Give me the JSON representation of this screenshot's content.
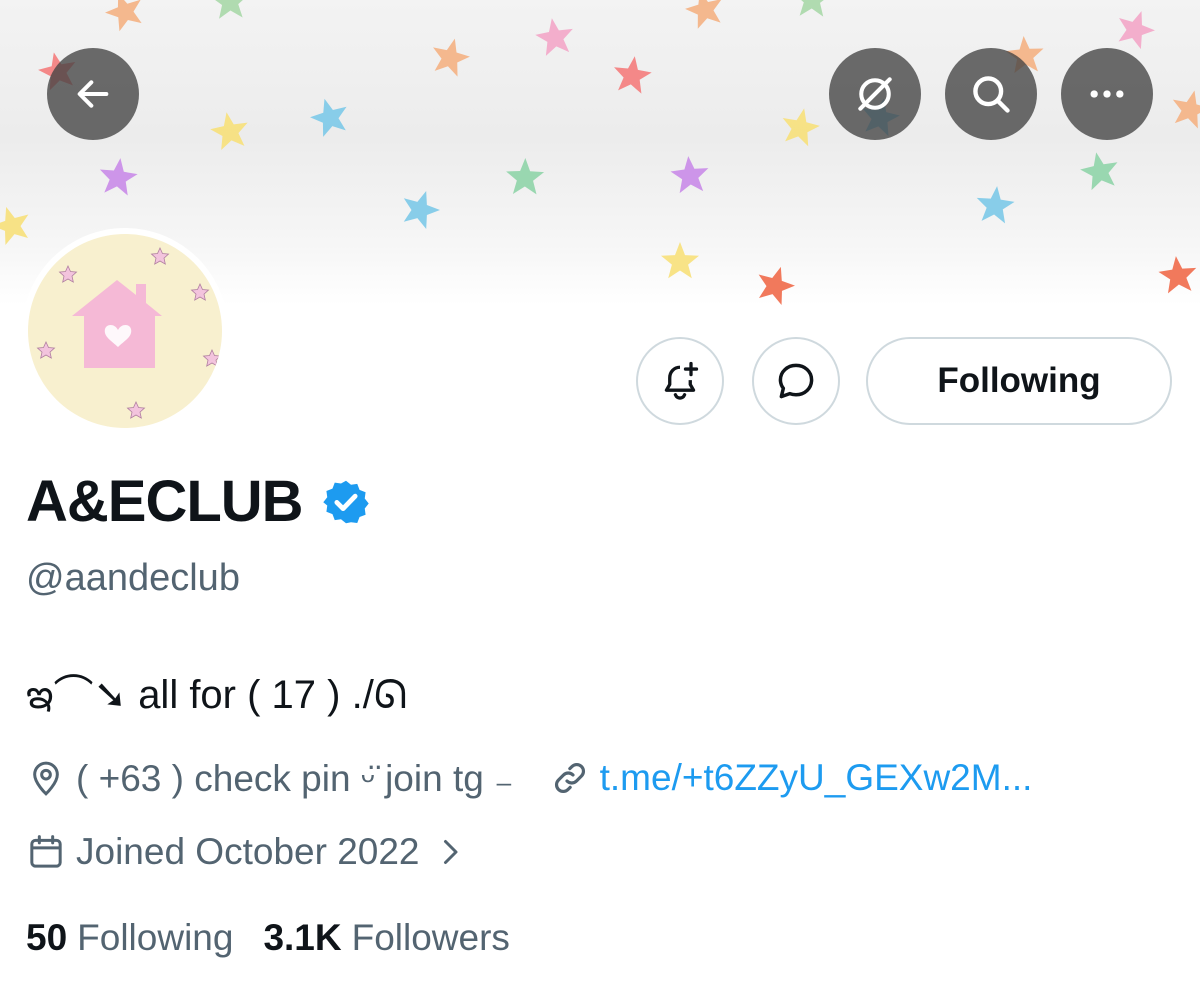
{
  "header": {
    "back_icon": "arrow-left-icon",
    "actions": [
      {
        "name": "grok-icon"
      },
      {
        "name": "search-icon"
      },
      {
        "name": "more-icon"
      }
    ]
  },
  "profile_actions": {
    "notify_icon": "bell-plus-icon",
    "message_icon": "chat-bubble-icon",
    "follow_button_label": "Following"
  },
  "profile": {
    "display_name": "A&ECLUB",
    "handle": "@aandeclub",
    "bio": "ఇ⌒➘ all for ( 17 ) ./ᘏ",
    "location": "( +63 ) check pin ᵕ̈ join tg ₋",
    "website": "t.me/+t6ZZyU_GEXw2M...",
    "joined": "Joined October 2022"
  },
  "stats": {
    "following_count": "50",
    "following_label": "Following",
    "followers_count": "3.1K",
    "followers_label": "Followers"
  },
  "colors": {
    "accent": "#1d9bf0",
    "secondary_text": "#536471",
    "verified_badge": "#1d9bf0",
    "avatar_bg": "#f8f0cf",
    "avatar_house": "#f5b9d6"
  }
}
